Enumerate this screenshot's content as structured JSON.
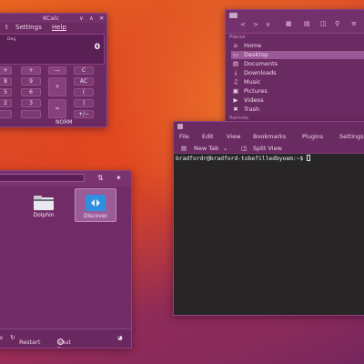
{
  "kcalc": {
    "title": "KCalc",
    "window_controls": [
      "∨",
      "∧",
      "✕"
    ],
    "menu": [
      "t",
      "Settings",
      "Help"
    ],
    "angle_mode": "Deg",
    "display_value": "0",
    "keys": {
      "row1": [
        "+",
        "+",
        "—",
        "C"
      ],
      "row2": [
        "8",
        "9",
        "AC"
      ],
      "row3": [
        "5",
        "6",
        "("
      ],
      "row4": [
        "2",
        "3",
        ")"
      ],
      "row5": [
        "+/−"
      ],
      "plus": "+",
      "equals": "="
    },
    "status": "NORM"
  },
  "dolphin": {
    "nav": [
      "<",
      ">",
      "∨"
    ],
    "places_header": "Places",
    "remote_header": "Remote",
    "places": [
      {
        "label": "Home",
        "icon": "⌂"
      },
      {
        "label": "Desktop",
        "icon": "▭"
      },
      {
        "label": "Documents",
        "icon": "▤"
      },
      {
        "label": "Downloads",
        "icon": "⤓"
      },
      {
        "label": "Music",
        "icon": "♫"
      },
      {
        "label": "Pictures",
        "icon": "▣"
      },
      {
        "label": "Videos",
        "icon": "▶"
      },
      {
        "label": "Trash",
        "icon": "✖"
      }
    ],
    "selected_place": "Desktop"
  },
  "konsole": {
    "menu": [
      "File",
      "Edit",
      "View",
      "Bookmarks",
      "Plugins",
      "Settings"
    ],
    "new_tab": "New Tab",
    "split_view": "Split View",
    "prompt": "bradfordr@bradford-tobefilledbyoem:~$ "
  },
  "launcher": {
    "apps": [
      {
        "label": "Dolphin"
      },
      {
        "label": "Discover"
      }
    ],
    "selected_app": "Discover",
    "power": {
      "restart": "Restart",
      "shutdown": "Shut Down",
      "left_cut": "e"
    }
  },
  "colors": {
    "window_bg": "#6a2a62",
    "selection": "#9b5896",
    "terminal_bg": "#272526"
  }
}
